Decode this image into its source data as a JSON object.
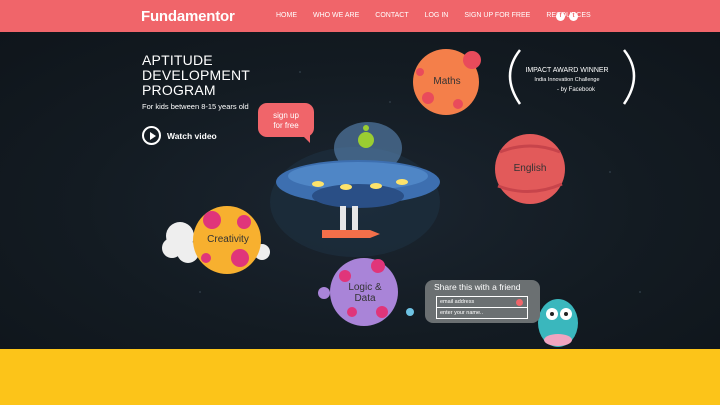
{
  "nav": {
    "logo": "Fundamentor",
    "items": [
      "HOME",
      "WHO WE ARE",
      "CONTACT",
      "LOG IN",
      "SIGN UP FOR FREE",
      "RESOURCES"
    ]
  },
  "hero": {
    "title_lines": [
      "APTITUDE",
      "DEVELOPMENT",
      "PROGRAM"
    ],
    "subtitle": "For kids between 8-15 years old",
    "watch_video": "Watch video",
    "signup_bubble": [
      "sign up",
      "for free"
    ]
  },
  "planets": {
    "maths": "Maths",
    "english": "English",
    "creativity": "Creativity",
    "logic": [
      "Logic &",
      "Data"
    ]
  },
  "award": {
    "line1": "IMPACT AWARD WINNER",
    "line2": "India Innovation Challenge",
    "line3": "- by Facebook"
  },
  "share": {
    "title": "Share this with a friend",
    "email_placeholder": "email address",
    "name_placeholder": "enter your name.."
  },
  "colors": {
    "brand": "#f0656a",
    "yellow": "#fcc419",
    "dark": "#121c22"
  }
}
